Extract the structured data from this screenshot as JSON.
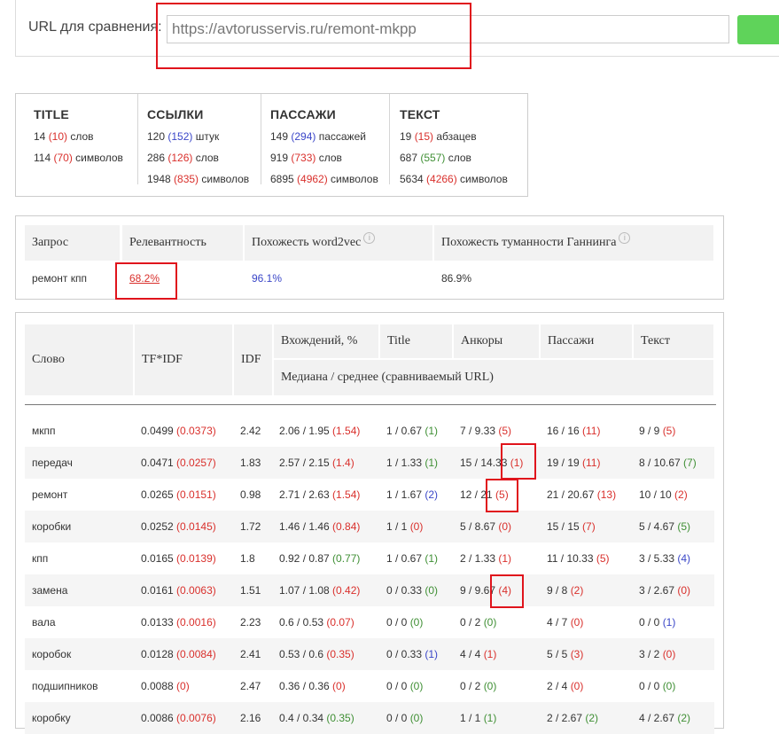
{
  "url_bar": {
    "label": "URL для сравнения:",
    "value": "https://avtorusservis.ru/remont-mkpp"
  },
  "stats": [
    {
      "title": "TITLE",
      "lines": [
        [
          {
            "t": "14 "
          },
          {
            "t": "(10)",
            "c": "red"
          },
          {
            "t": " слов"
          }
        ],
        [
          {
            "t": "114 "
          },
          {
            "t": "(70)",
            "c": "red"
          },
          {
            "t": " символов"
          }
        ]
      ]
    },
    {
      "title": "ССЫЛКИ",
      "lines": [
        [
          {
            "t": "120 "
          },
          {
            "t": "(152)",
            "c": "blue"
          },
          {
            "t": " штук"
          }
        ],
        [
          {
            "t": "286 "
          },
          {
            "t": "(126)",
            "c": "red"
          },
          {
            "t": " слов"
          }
        ],
        [
          {
            "t": "1948 "
          },
          {
            "t": "(835)",
            "c": "red"
          },
          {
            "t": " символов"
          }
        ]
      ]
    },
    {
      "title": "ПАССАЖИ",
      "lines": [
        [
          {
            "t": "149 "
          },
          {
            "t": "(294)",
            "c": "blue"
          },
          {
            "t": " пассажей"
          }
        ],
        [
          {
            "t": "919 "
          },
          {
            "t": "(733)",
            "c": "red"
          },
          {
            "t": " слов"
          }
        ],
        [
          {
            "t": "6895 "
          },
          {
            "t": "(4962)",
            "c": "red"
          },
          {
            "t": " символов"
          }
        ]
      ]
    },
    {
      "title": "ТЕКСТ",
      "lines": [
        [
          {
            "t": "19 "
          },
          {
            "t": "(15)",
            "c": "red"
          },
          {
            "t": " абзацев"
          }
        ],
        [
          {
            "t": "687 "
          },
          {
            "t": "(557)",
            "c": "green"
          },
          {
            "t": " слов"
          }
        ],
        [
          {
            "t": "5634 "
          },
          {
            "t": "(4266)",
            "c": "red"
          },
          {
            "t": " символов"
          }
        ]
      ]
    }
  ],
  "query_table": {
    "headers": {
      "query": "Запрос",
      "relevance": "Релевантность",
      "word2vec": "Похожесть word2vec",
      "gunning": "Похожесть туманности Ганнинга"
    },
    "row": {
      "query": "ремонт кпп",
      "relevance": "68.2%",
      "word2vec": "96.1%",
      "gunning": "86.9%"
    }
  },
  "words_table": {
    "headers": {
      "word": "Слово",
      "tfidf": "TF*IDF",
      "idf": "IDF",
      "occurrences": "Вхождений, %",
      "title": "Title",
      "anchors": "Анкоры",
      "passages": "Пассажи",
      "text": "Текст",
      "subheader": "Медиана / среднее (сравниваемый URL)"
    },
    "rows": [
      {
        "word": "мкпп",
        "tfidf": [
          "0.0499 ",
          {
            "t": "(0.0373)",
            "c": "red"
          }
        ],
        "idf": "2.42",
        "occ": [
          "2.06 / 1.95 ",
          {
            "t": "(1.54)",
            "c": "red"
          }
        ],
        "title": [
          "1 / 0.67 ",
          {
            "t": "(1)",
            "c": "green"
          }
        ],
        "anch": [
          "7 / 9.33 ",
          {
            "t": "(5)",
            "c": "red"
          }
        ],
        "pass": [
          "16 / 16 ",
          {
            "t": "(11)",
            "c": "red"
          }
        ],
        "text": [
          "9 / 9 ",
          {
            "t": "(5)",
            "c": "red"
          }
        ]
      },
      {
        "word": "передач",
        "tfidf": [
          "0.0471 ",
          {
            "t": "(0.0257)",
            "c": "red"
          }
        ],
        "idf": "1.83",
        "occ": [
          "2.57 / 2.15 ",
          {
            "t": "(1.4)",
            "c": "red"
          }
        ],
        "title": [
          "1 / 1.33 ",
          {
            "t": "(1)",
            "c": "green"
          }
        ],
        "anch": [
          "15 / 14.33 ",
          {
            "t": "(1)",
            "c": "red"
          }
        ],
        "pass": [
          "19 / 19 ",
          {
            "t": "(11)",
            "c": "red"
          }
        ],
        "text": [
          "8 / 10.67 ",
          {
            "t": "(7)",
            "c": "green"
          }
        ]
      },
      {
        "word": "ремонт",
        "tfidf": [
          "0.0265 ",
          {
            "t": "(0.0151)",
            "c": "red"
          }
        ],
        "idf": "0.98",
        "occ": [
          "2.71 / 2.63 ",
          {
            "t": "(1.54)",
            "c": "red"
          }
        ],
        "title": [
          "1 / 1.67 ",
          {
            "t": "(2)",
            "c": "blue"
          }
        ],
        "anch": [
          "12 / 21 ",
          {
            "t": "(5)",
            "c": "red"
          }
        ],
        "pass": [
          "21 / 20.67 ",
          {
            "t": "(13)",
            "c": "red"
          }
        ],
        "text": [
          "10 / 10 ",
          {
            "t": "(2)",
            "c": "red"
          }
        ]
      },
      {
        "word": "коробки",
        "tfidf": [
          "0.0252 ",
          {
            "t": "(0.0145)",
            "c": "red"
          }
        ],
        "idf": "1.72",
        "occ": [
          "1.46 / 1.46 ",
          {
            "t": "(0.84)",
            "c": "red"
          }
        ],
        "title": [
          "1 / 1 ",
          {
            "t": "(0)",
            "c": "red"
          }
        ],
        "anch": [
          "5 / 8.67 ",
          {
            "t": "(0)",
            "c": "red"
          }
        ],
        "pass": [
          "15 / 15 ",
          {
            "t": "(7)",
            "c": "red"
          }
        ],
        "text": [
          "5 / 4.67 ",
          {
            "t": "(5)",
            "c": "green"
          }
        ]
      },
      {
        "word": "кпп",
        "tfidf": [
          "0.0165 ",
          {
            "t": "(0.0139)",
            "c": "red"
          }
        ],
        "idf": "1.8",
        "occ": [
          "0.92 / 0.87 ",
          {
            "t": "(0.77)",
            "c": "green"
          }
        ],
        "title": [
          "1 / 0.67 ",
          {
            "t": "(1)",
            "c": "green"
          }
        ],
        "anch": [
          "2 / 1.33 ",
          {
            "t": "(1)",
            "c": "red"
          }
        ],
        "pass": [
          "11 / 10.33 ",
          {
            "t": "(5)",
            "c": "red"
          }
        ],
        "text": [
          "3 / 5.33 ",
          {
            "t": "(4)",
            "c": "blue"
          }
        ]
      },
      {
        "word": "замена",
        "tfidf": [
          "0.0161 ",
          {
            "t": "(0.0063)",
            "c": "red"
          }
        ],
        "idf": "1.51",
        "occ": [
          "1.07 / 1.08 ",
          {
            "t": "(0.42)",
            "c": "red"
          }
        ],
        "title": [
          "0 / 0.33 ",
          {
            "t": "(0)",
            "c": "green"
          }
        ],
        "anch": [
          "9 / 9.67 ",
          {
            "t": "(4)",
            "c": "red"
          }
        ],
        "pass": [
          "9 / 8 ",
          {
            "t": "(2)",
            "c": "red"
          }
        ],
        "text": [
          "3 / 2.67 ",
          {
            "t": "(0)",
            "c": "red"
          }
        ]
      },
      {
        "word": "вала",
        "tfidf": [
          "0.0133 ",
          {
            "t": "(0.0016)",
            "c": "red"
          }
        ],
        "idf": "2.23",
        "occ": [
          "0.6 / 0.53 ",
          {
            "t": "(0.07)",
            "c": "red"
          }
        ],
        "title": [
          "0 / 0 ",
          {
            "t": "(0)",
            "c": "green"
          }
        ],
        "anch": [
          "0 / 2 ",
          {
            "t": "(0)",
            "c": "green"
          }
        ],
        "pass": [
          "4 / 7 ",
          {
            "t": "(0)",
            "c": "red"
          }
        ],
        "text": [
          "0 / 0 ",
          {
            "t": "(1)",
            "c": "blue"
          }
        ]
      },
      {
        "word": "коробок",
        "tfidf": [
          "0.0128 ",
          {
            "t": "(0.0084)",
            "c": "red"
          }
        ],
        "idf": "2.41",
        "occ": [
          "0.53 / 0.6 ",
          {
            "t": "(0.35)",
            "c": "red"
          }
        ],
        "title": [
          "0 / 0.33 ",
          {
            "t": "(1)",
            "c": "blue"
          }
        ],
        "anch": [
          "4 / 4 ",
          {
            "t": "(1)",
            "c": "red"
          }
        ],
        "pass": [
          "5 / 5 ",
          {
            "t": "(3)",
            "c": "red"
          }
        ],
        "text": [
          "3 / 2 ",
          {
            "t": "(0)",
            "c": "red"
          }
        ]
      },
      {
        "word": "подшипников",
        "tfidf": [
          "0.0088 ",
          {
            "t": "(0)",
            "c": "red"
          }
        ],
        "idf": "2.47",
        "occ": [
          "0.36 / 0.36 ",
          {
            "t": "(0)",
            "c": "red"
          }
        ],
        "title": [
          "0 / 0 ",
          {
            "t": "(0)",
            "c": "green"
          }
        ],
        "anch": [
          "0 / 2 ",
          {
            "t": "(0)",
            "c": "green"
          }
        ],
        "pass": [
          "2 / 4 ",
          {
            "t": "(0)",
            "c": "red"
          }
        ],
        "text": [
          "0 / 0 ",
          {
            "t": "(0)",
            "c": "green"
          }
        ]
      },
      {
        "word": "коробку",
        "tfidf": [
          "0.0086 ",
          {
            "t": "(0.0076)",
            "c": "red"
          }
        ],
        "idf": "2.16",
        "occ": [
          "0.4 / 0.34 ",
          {
            "t": "(0.35)",
            "c": "green"
          }
        ],
        "title": [
          "0 / 0 ",
          {
            "t": "(0)",
            "c": "green"
          }
        ],
        "anch": [
          "1 / 1 ",
          {
            "t": "(1)",
            "c": "green"
          }
        ],
        "pass": [
          "2 / 2.67 ",
          {
            "t": "(2)",
            "c": "green"
          }
        ],
        "text": [
          "4 / 2.67 ",
          {
            "t": "(2)",
            "c": "green"
          }
        ]
      }
    ]
  }
}
